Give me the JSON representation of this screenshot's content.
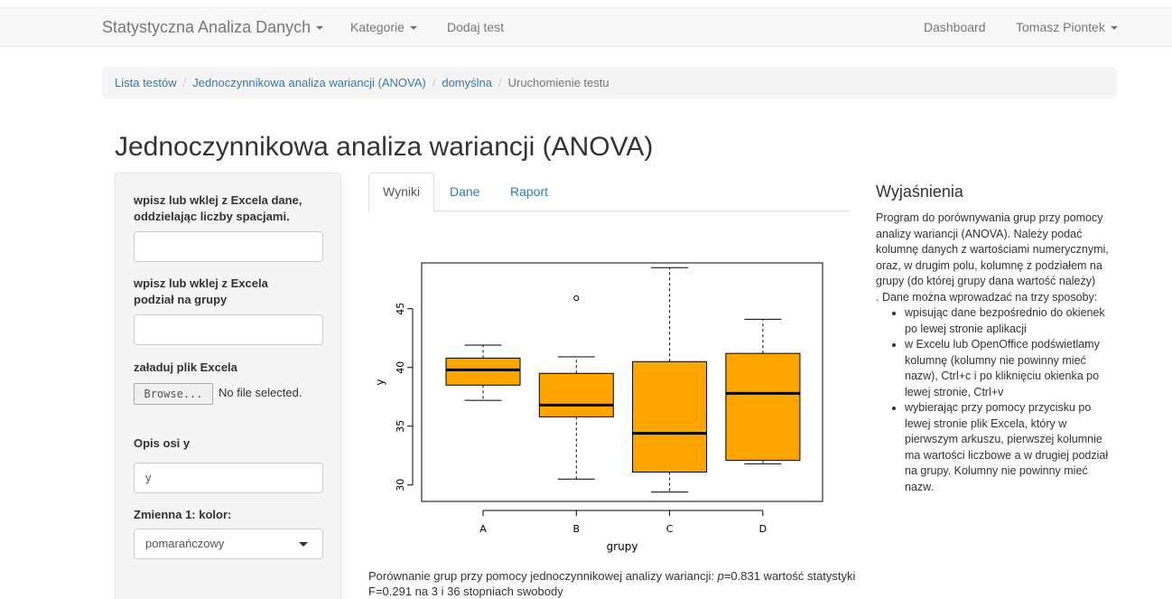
{
  "navbar": {
    "brand": "Statystyczna Analiza Danych",
    "kategorie": "Kategorie",
    "dodaj_test": "Dodaj test",
    "dashboard": "Dashboard",
    "user": "Tomasz Piontek"
  },
  "breadcrumb": {
    "items": [
      "Lista testów",
      "Jednoczynnikowa analiza wariancji (ANOVA)",
      "domyślna",
      "Uruchomienie testu"
    ],
    "separator": "/"
  },
  "page_title": "Jednoczynnikowa analiza wariancji (ANOVA)",
  "sidebar": {
    "data_label": "wpisz lub wklej z Excela dane, oddzielając liczby spacjami.",
    "data_value": "",
    "groups_label": "wpisz lub wklej z Excela podział na grupy",
    "groups_value": "",
    "file_label": "załaduj plik Excela",
    "browse_button": "Browse...",
    "file_status": "No file selected.",
    "axis_label": "Opis osi y",
    "axis_value": "y",
    "color_label": "Zmienna 1: kolor:",
    "color_value": "pomarańczowy"
  },
  "tabs": [
    "Wyniki",
    "Dane",
    "Raport"
  ],
  "active_tab": "Wyniki",
  "chart_data": {
    "type": "boxplot",
    "xlabel": "grupy",
    "ylabel": "y",
    "categories": [
      "A",
      "B",
      "C",
      "D"
    ],
    "yticks": [
      30,
      35,
      40,
      45
    ],
    "ylim": [
      28.6,
      48.9
    ],
    "box_color": "#ffa500",
    "boxes": [
      {
        "name": "A",
        "whisker_low": 37.2,
        "q1": 38.5,
        "median": 39.8,
        "q3": 40.8,
        "whisker_high": 41.9,
        "outliers": []
      },
      {
        "name": "B",
        "whisker_low": 30.5,
        "q1": 35.8,
        "median": 36.8,
        "q3": 39.5,
        "whisker_high": 40.9,
        "outliers": [
          45.9
        ]
      },
      {
        "name": "C",
        "whisker_low": 29.4,
        "q1": 31.1,
        "median": 34.4,
        "q3": 40.5,
        "whisker_high": 48.5,
        "outliers": []
      },
      {
        "name": "D",
        "whisker_low": 31.8,
        "q1": 32.1,
        "median": 37.8,
        "q3": 41.2,
        "whisker_high": 44.1,
        "outliers": []
      }
    ]
  },
  "summary": {
    "prefix": "Porównanie grup przy pomocy jednoczynnikowej analizy wariancji: ",
    "p_symbol": "p",
    "rest": "=0.831 wartość statystyki F=0.291 na 3 i 36 stopniach swobody"
  },
  "explanations": {
    "title": "Wyjaśnienia",
    "intro": "Program do porównywania grup przy pomocy analizy wariancji (ANOVA). Należy podać kolumnę danych z wartościami numerycznymi, oraz, w drugim polu, kolumnę z podziałem na grupy (do której grupy dana wartość należy)",
    "ways_intro": ". Dane można wprowadzać na trzy sposoby:",
    "ways": [
      "wpisując dane bezpośrednio do okienek po lewej stronie aplikacji",
      "w Excelu lub OpenOffice podświetlamy kolumnę (kolumny nie powinny mieć nazw), Ctrl+c i po kliknięciu okienka po lewej stronie, Ctrl+v",
      "wybierając przy pomocy przycisku po lewej stronie plik Excela, który w pierwszym arkuszu, pierwszej kolumnie ma wartości liczbowe a w drugiej podział na grupy. Kolumny nie powinny mieć nazw."
    ]
  }
}
